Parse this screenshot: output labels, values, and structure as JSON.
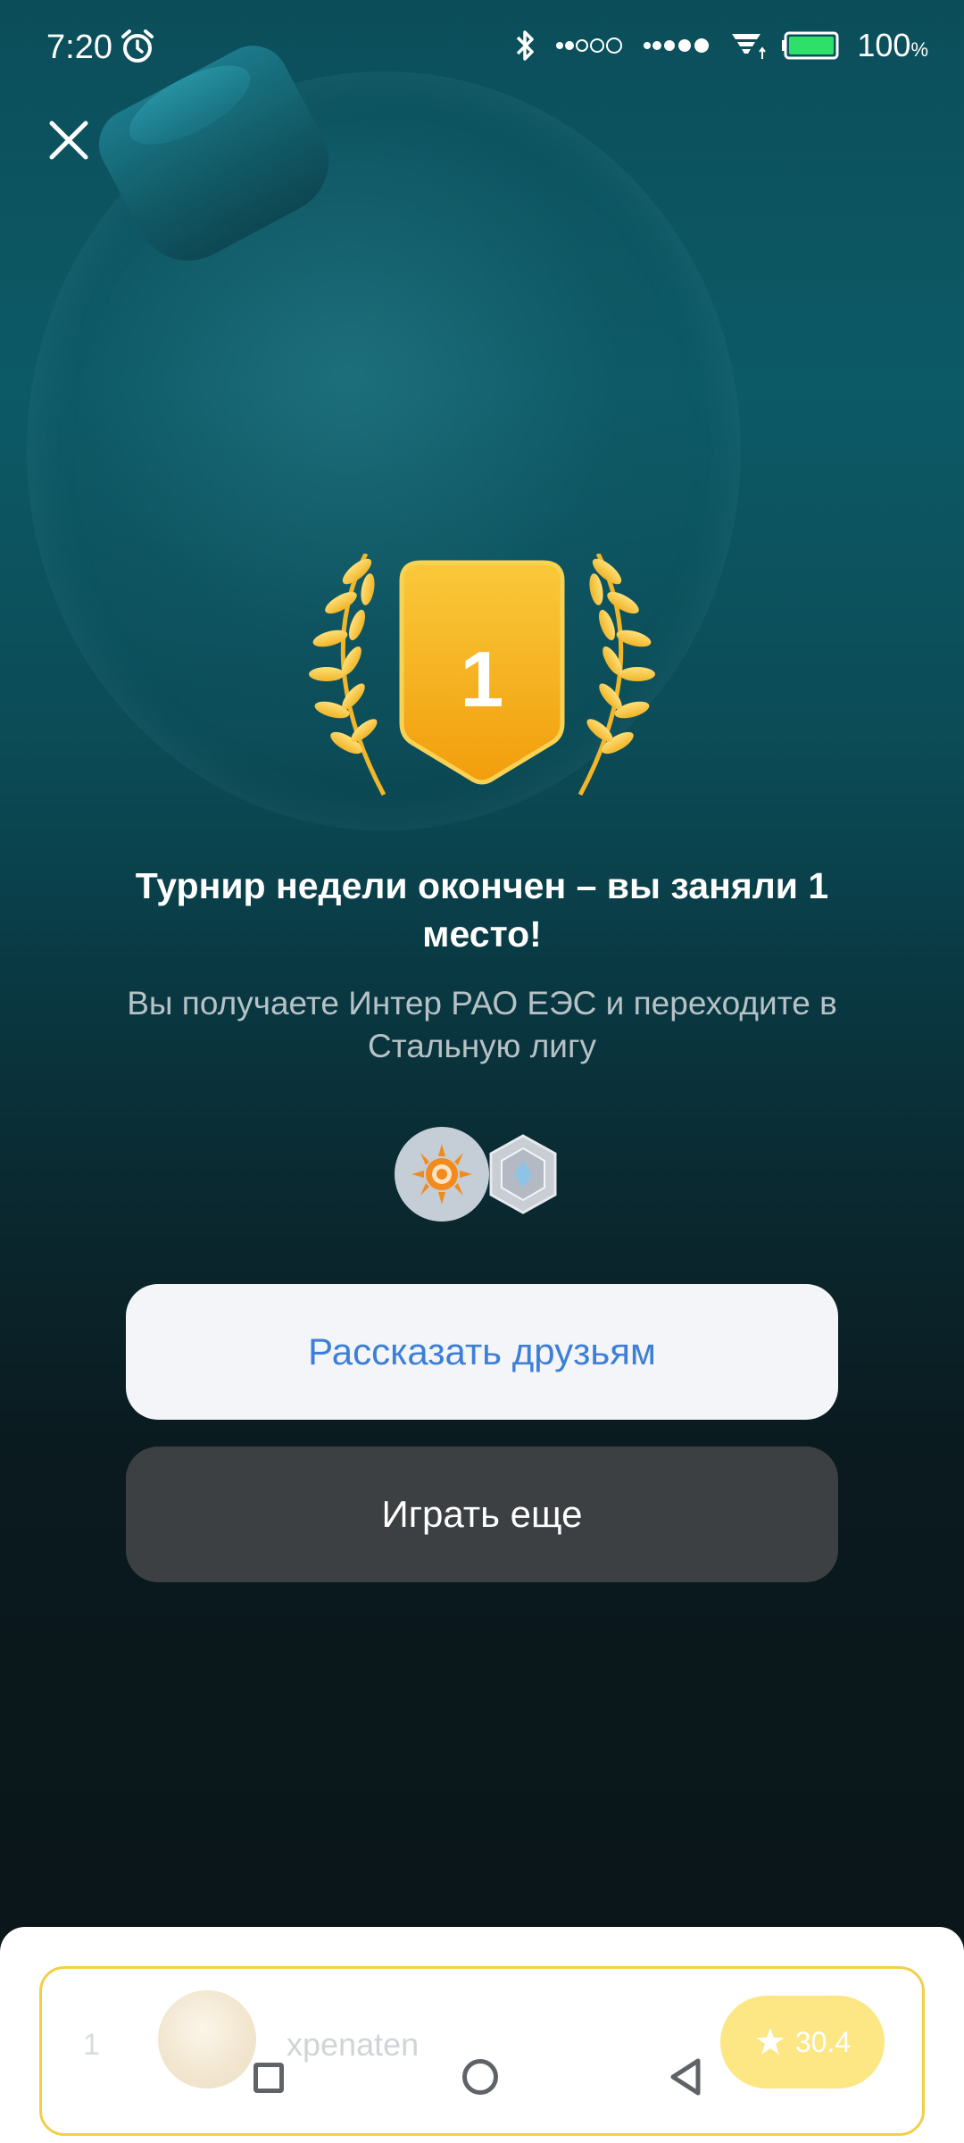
{
  "status_bar": {
    "time": "7:20",
    "battery_percent": "100",
    "battery_unit": "%",
    "icons": [
      "alarm-icon",
      "bluetooth-icon",
      "signal-1-icon",
      "signal-2-icon",
      "wifi-icon",
      "battery-icon"
    ]
  },
  "close": {
    "icon": "close-icon"
  },
  "trophy": {
    "rank": "1",
    "color": "#f6b21a"
  },
  "title": "Турнир недели окончен – вы заняли 1 место!",
  "subtitle": "Вы получаете Интер РАО ЕЭС и переходите в Стальную лигу",
  "rewards": [
    "company-logo-icon",
    "steel-league-badge-icon"
  ],
  "buttons": {
    "share_label": "Рассказать друзьям",
    "play_label": "Играть еще"
  },
  "leaderboard_row": {
    "rank": "1",
    "username": "xpenaten",
    "score": "30.4"
  },
  "nav": {
    "icons": [
      "recent-apps-icon",
      "home-icon",
      "back-icon"
    ]
  },
  "colors": {
    "accent_blue": "#3d7fd6",
    "gold": "#f6b21a",
    "row_border": "#f3cf48"
  }
}
